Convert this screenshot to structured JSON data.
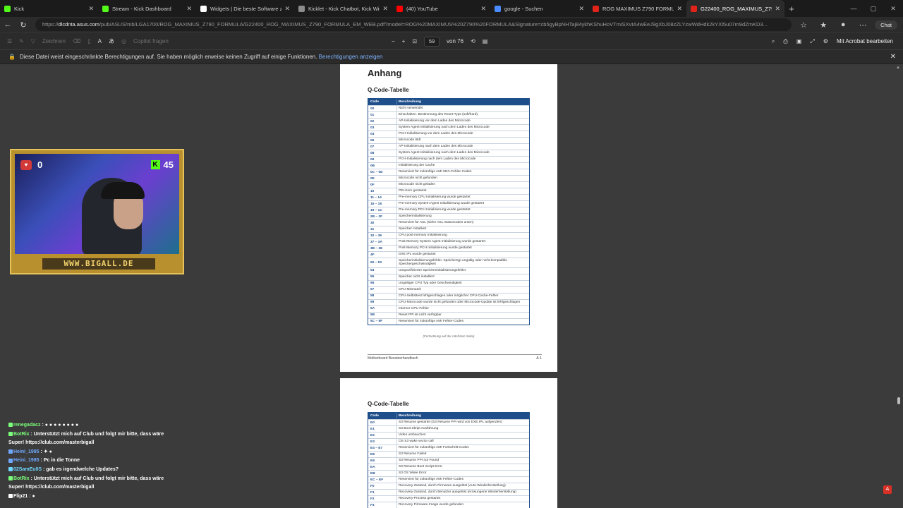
{
  "tabs": [
    {
      "title": "Kick",
      "color": "#53fc18"
    },
    {
      "title": "Stream - Kick Dashboard",
      "color": "#53fc18"
    },
    {
      "title": "Widgets | Die beste Software zur C",
      "color": "#ffffff"
    },
    {
      "title": "Kicklet - Kick Chatbot, Kick Widge",
      "color": "#8c8c8c"
    },
    {
      "title": "(40) YouTube",
      "color": "#ff0000"
    },
    {
      "title": "google - Suchen",
      "color": "#4a8cff"
    },
    {
      "title": "ROG MAXIMUS Z790 FORMULA | R",
      "color": "#e2231a"
    },
    {
      "title": "G22400_ROG_MAXIMUS_Z790_FO",
      "color": "#e2231a"
    }
  ],
  "address": {
    "url_prefix": "https://",
    "url_host": "dlcdnta.asus.com",
    "url_rest": "/pub/ASUS/mb/LGA1700/ROG_MAXIMUS_Z790_FORMULA/G22400_ROG_MAXIMUS_Z790_FORMULA_EM_WEB.pdf?model=ROG%20MAXIMUS%20Z790%20FORMULA&Signature=cb5gyBpNHTaj84ykhKShuHoVTmiSXvtA4wEeJ9gXbJ08zZLYzwWdHdk2kYXl5u07m9dZmKD3...",
    "chat_label": "Chat"
  },
  "pdf_toolbar": {
    "draw_label": "Zeichnen",
    "copilot_label": "Copilot fragen",
    "page_current": "59",
    "page_total": "von 76",
    "acrobat_label": "Mit Acrobat bearbeiten"
  },
  "infobar": {
    "text": "Diese Datei weist eingeschränkte Berechtigungen auf. Sie haben möglich erweise keinen Zugriff auf einige Funktionen.",
    "link": "Berechtigungen anzeigen"
  },
  "page1": {
    "heading": "Anhang",
    "subheading": "Q-Code-Tabelle",
    "col_code": "Code",
    "col_desc": "Beschreibung",
    "rows": [
      {
        "code": "00",
        "desc": "Nicht verwendet"
      },
      {
        "code": "01",
        "desc": "Einschalten. Bestimmung des Reset-Typs (soft/hard)."
      },
      {
        "code": "02",
        "desc": "AP-Initialisierung vor dem Laden des Microcode"
      },
      {
        "code": "03",
        "desc": "System Agent-Initialisierung nach dem Laden des Microcode"
      },
      {
        "code": "04",
        "desc": "PCH-Initialisierung vor dem Laden des Microcode"
      },
      {
        "code": "06",
        "desc": "Microcode lädt"
      },
      {
        "code": "07",
        "desc": "AP-Initialisierung nach dem Laden des Microcode"
      },
      {
        "code": "08",
        "desc": "System Agent-Initialisierung nach dem Laden des Microcode"
      },
      {
        "code": "09",
        "desc": "PCH-Initialisierung nach dem Laden des Microcode"
      },
      {
        "code": "0B",
        "desc": "Initialisierung der Cache"
      },
      {
        "code": "0C – 0D",
        "desc": "Reserviert für zukünftige AMI SEC-Fehler-Codes"
      },
      {
        "code": "0E",
        "desc": "Microcode nicht gefunden"
      },
      {
        "code": "0F",
        "desc": "Microcode nicht geladen"
      },
      {
        "code": "10",
        "desc": "PEI-Kern gestartet"
      },
      {
        "code": "11 – 14",
        "desc": "Pre-memory CPU Initialisierung wurde gestartet"
      },
      {
        "code": "15 – 18",
        "desc": "Pre-memory System Agent Initialisierung wurde gestartet"
      },
      {
        "code": "19 – 1C",
        "desc": "Pre-memory PCH Initialisierung wurde gestartet"
      },
      {
        "code": "2B – 2F",
        "desc": "Speicherinitialisierung"
      },
      {
        "code": "30",
        "desc": "Reserviert für ASL (siehe ASL-Statuscodes unten)"
      },
      {
        "code": "31",
        "desc": "Speicher installiert"
      },
      {
        "code": "32 – 36",
        "desc": "CPU post-memory Initialisierung"
      },
      {
        "code": "37 – 3A",
        "desc": "Post-Memory System Agent Initialisierung wurde gestartet"
      },
      {
        "code": "3B – 3E",
        "desc": "Post-Memory PCH Initialisierung wurde gestartet"
      },
      {
        "code": "4F",
        "desc": "DXE IPL wurde gestartet"
      },
      {
        "code": "50 – 53",
        "desc": "Speicherinitialisierungsfehler. Speichertyp ungültig oder nicht kompatible Speichergeschwindigkeit"
      },
      {
        "code": "54",
        "desc": "Unspezifizierter Speicherinitialisierungsfehler"
      },
      {
        "code": "55",
        "desc": "Speicher nicht installiert"
      },
      {
        "code": "56",
        "desc": "Ungültiger CPU Typ oder Geschwindigkeit"
      },
      {
        "code": "57",
        "desc": "CPU Mismatch"
      },
      {
        "code": "58",
        "desc": "CPU-Selbsttest fehlgeschlagen oder möglicher CPU-Cache-Fehler"
      },
      {
        "code": "59",
        "desc": "CPU-Microcode wurde nicht gefunden oder Microcode-Update ist fehlgeschlagen"
      },
      {
        "code": "5A",
        "desc": "Interner CPU Fehler"
      },
      {
        "code": "5B",
        "desc": "Reset PPI ist nicht verfügbar"
      },
      {
        "code": "5C – 5F",
        "desc": "Reserviert für zukünftige AMI Fehler-Codes"
      }
    ],
    "continued": "(Fortsetzung auf der nächsten Seite)",
    "footer_left": "Motherboard Benutzerhandbuch",
    "footer_right": "A-1"
  },
  "page2": {
    "subheading": "Q-Code-Tabelle",
    "col_code": "Code",
    "col_desc": "Beschreibung",
    "rows": [
      {
        "code": "E0",
        "desc": "S3 Resume gestartet (S3 Resume PPI wird von DXE IPL aufgerufen)"
      },
      {
        "code": "E1",
        "desc": "S3 Boot Skript Ausführung"
      },
      {
        "code": "E2",
        "desc": "Video umbauchen"
      },
      {
        "code": "E3",
        "desc": "OS S3 wake vector call"
      },
      {
        "code": "E4 – E7",
        "desc": "Reserviert für zukünftige AMI Fortschritt-Codes"
      },
      {
        "code": "E8",
        "desc": "S3 Resume Failed"
      },
      {
        "code": "E9",
        "desc": "S3 Resume PPI not Found"
      },
      {
        "code": "EA",
        "desc": "S3 Resume Boot Script Error"
      },
      {
        "code": "EB",
        "desc": "S3 OS Wake Error"
      },
      {
        "code": "EC – EF",
        "desc": "Reserviert für zukünftige AMI Fehler-Codes"
      },
      {
        "code": "F0",
        "desc": "Recovery-Zustand, durch Firmware ausgelöst (Auto-Wiederherstellung)"
      },
      {
        "code": "F1",
        "desc": "Recovery-Zustand, durch Benutzer ausgelöst (erzwungene Wiederherstellung)"
      },
      {
        "code": "F2",
        "desc": "Recovery-Prozess gestartet"
      },
      {
        "code": "F3",
        "desc": "Recovery Firmware Image wurde gefunden"
      }
    ]
  },
  "overlay": {
    "hr_value": "0",
    "kick_value": "45",
    "site": "WWW.BIGALL.DE"
  },
  "chat": [
    {
      "user": "renegadacz",
      "user_color": "#7cff7c",
      "text": ":  ● ● ● ● ● ● ● ●"
    },
    {
      "user": "BotRix",
      "user_color": "#7cff7c",
      "text": ": Unterstützt mich auf Club und folgt mir bitte, dass wäre"
    },
    {
      "user": "",
      "user_color": "#ffffff",
      "text": "Super! https://club.com/masterbigall"
    },
    {
      "user": "Heini_1985",
      "user_color": "#6fa8ff",
      "text": ":  ✦ ●"
    },
    {
      "user": "Heini_1985",
      "user_color": "#6fa8ff",
      "text": ": Pc in die Tonne"
    },
    {
      "user": "02SamEu0S",
      "user_color": "#6fd7ff",
      "text": ": gab es irgendwelche Updates?"
    },
    {
      "user": "BotRix",
      "user_color": "#7cff7c",
      "text": ": Unterstützt mich auf Club und folgt mir bitte, dass wäre"
    },
    {
      "user": "",
      "user_color": "#ffffff",
      "text": "Super! https://club.com/masterbigall"
    },
    {
      "user": "Flip21",
      "user_color": "#ffffff",
      "text": ": ●"
    }
  ]
}
